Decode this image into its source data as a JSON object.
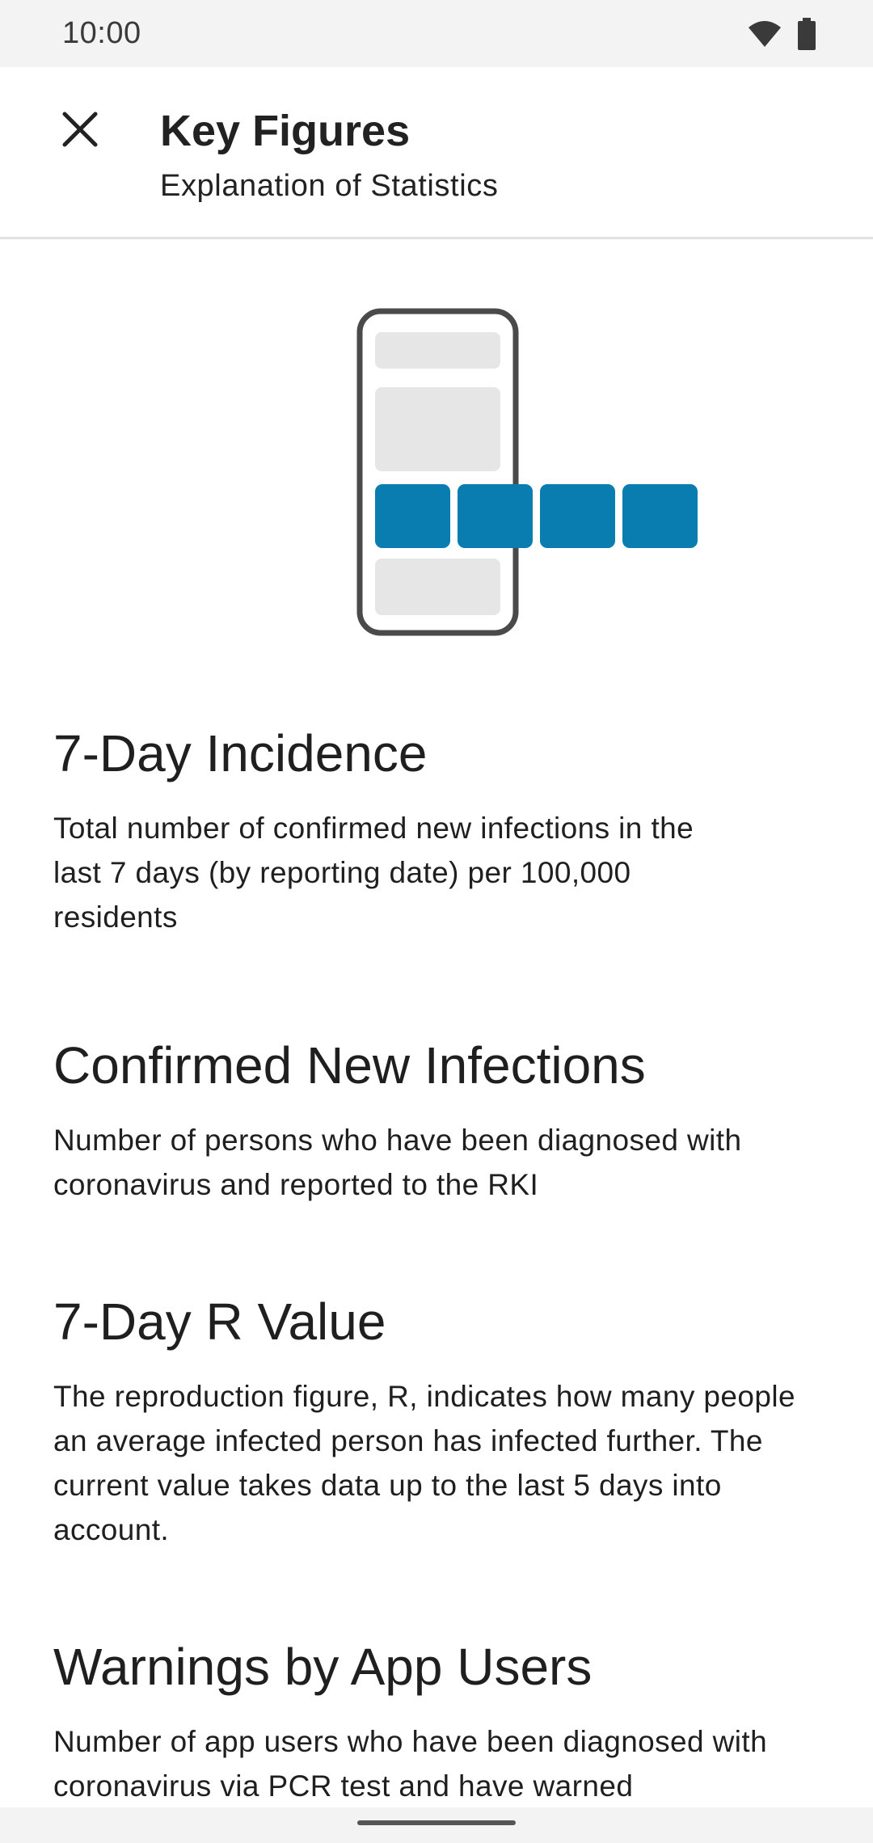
{
  "status_bar": {
    "time": "10:00",
    "icons": [
      "wifi-icon",
      "battery-icon"
    ]
  },
  "header": {
    "title": "Key Figures",
    "subtitle": "Explanation of Statistics",
    "close_icon": "close-icon"
  },
  "illustration": {
    "icon": "phone-key-figures-illustration",
    "accent_color": "#0a7db0",
    "placeholder_color": "#e6e6e6",
    "outline_color": "#4a4a4a"
  },
  "sections": [
    {
      "title": "7-Day Incidence",
      "body": "Total number of confirmed new infections in the last 7 days (by reporting date) per 100,000 residents"
    },
    {
      "title": "Confirmed New Infections",
      "body": "Number of persons who have been diagnosed with coronavirus and reported to the RKI"
    },
    {
      "title": "7-Day R Value",
      "body": "The reproduction figure, R, indicates how many people an average infected person has infected further. The current value takes data up to the last 5 days into account."
    },
    {
      "title": "Warnings by App Users",
      "body": "Number of app users who have been diagnosed with coronavirus via PCR test and have warned"
    }
  ]
}
